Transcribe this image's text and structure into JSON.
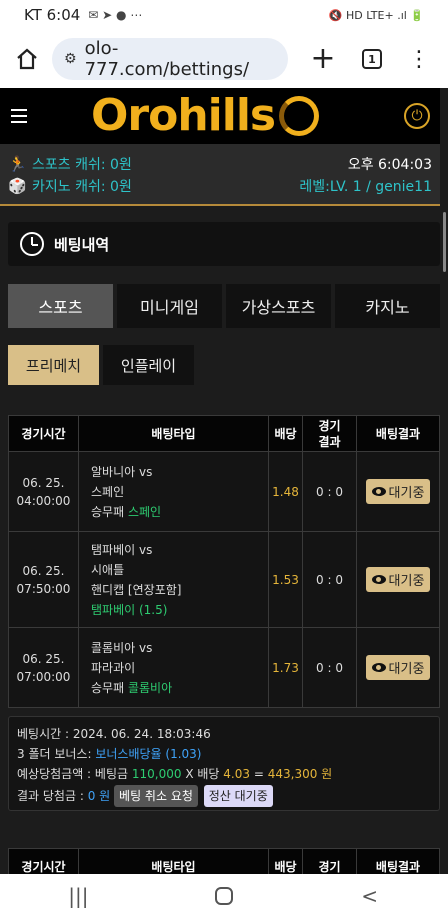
{
  "status": {
    "carrier_time": "KT 6:04",
    "icons": "✉ ➤ ● ⋯",
    "right_icons": "🔇 HD LTE+ .ıl 🔋"
  },
  "browser": {
    "url": "olo-777.com/bettings/",
    "tab_count": "1"
  },
  "site": {
    "logo_text": "Orohills",
    "sports_cash_label": "스포츠 캐쉬:",
    "sports_cash_value": "0원",
    "casino_cash_label": "카지노 캐쉬:",
    "casino_cash_value": "0원",
    "clock": "오후 6:04:03",
    "level": "레벨:LV. 1 / genie11"
  },
  "section": {
    "title": "베팅내역"
  },
  "tabs": [
    {
      "label": "스포츠"
    },
    {
      "label": "미니게임"
    },
    {
      "label": "가상스포츠"
    },
    {
      "label": "카지노"
    }
  ],
  "subtabs": [
    {
      "label": "프리메치"
    },
    {
      "label": "인플레이"
    }
  ],
  "table": {
    "headers": {
      "time": "경기시간",
      "type": "배팅타입",
      "odds": "배당",
      "result_top": "경기",
      "result_bottom": "결과",
      "bet_result": "배팅결과"
    },
    "rows": [
      {
        "date": "06. 25.",
        "time": "04:00:00",
        "line1": "알바니아 vs",
        "line2": "스페인",
        "market": "승무패",
        "pick": "스페인",
        "odds": "1.48",
        "score": "0 : 0",
        "status": "대기중"
      },
      {
        "date": "06. 25.",
        "time": "07:50:00",
        "line1": "탬파베이 vs",
        "line2": "시애틀",
        "line3": "핸디캡 [연장포함]",
        "pick": "탬파베이 (1.5)",
        "odds": "1.53",
        "score": "0 : 0",
        "status": "대기중"
      },
      {
        "date": "06. 25.",
        "time": "07:00:00",
        "line1": "콜롬비아 vs",
        "line2": "파라과이",
        "market": "승무패",
        "pick": "콜롬비아",
        "odds": "1.73",
        "score": "0 : 0",
        "status": "대기중"
      }
    ]
  },
  "summary": {
    "bet_time_label": "베팅시간 :",
    "bet_time": "2024. 06. 24. 18:03:46",
    "bonus_label": "3 폴더 보너스:",
    "bonus_value": "보너스배당율 (1.03)",
    "expected_label": "예상당첨금액 : 베팅금",
    "amount": "110,000",
    "x_odds": "X 배당",
    "total_odds": "4.03",
    "equals": "=",
    "payout": "443,300 원",
    "result_label": "결과 당첨금 :",
    "result_value": "0 원",
    "cancel_button": "베팅 취소 요청",
    "settle_button": "정산 대기중"
  },
  "table2_headers": {
    "time": "경기시간",
    "type": "배팅타입",
    "odds": "배당",
    "result_top": "경기",
    "bet_result": "배팅결과"
  },
  "navbar": {
    "recents": "|||",
    "back": "<"
  }
}
